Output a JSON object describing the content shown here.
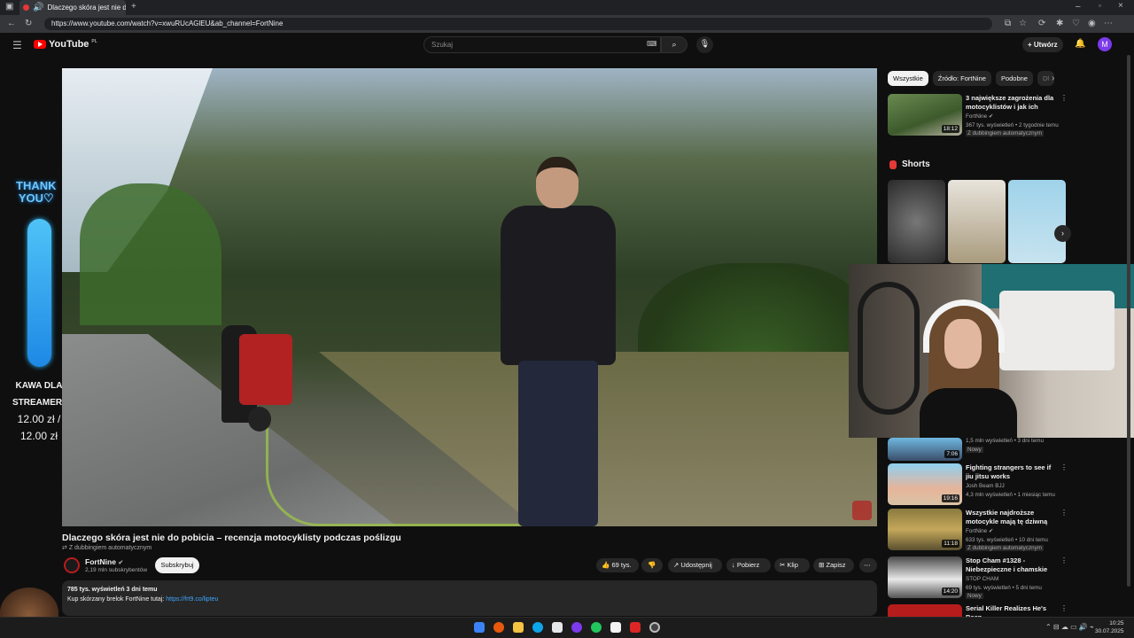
{
  "browser": {
    "tab_title": "Dlaczego skóra jest nie do p",
    "url": "https://www.youtube.com/watch?v=xwuRUcAGlEU&ab_channel=FortNine"
  },
  "youtube": {
    "logo_text": "YouTube",
    "logo_region": "PL",
    "search_placeholder": "Szukaj",
    "create_label": "Utwórz",
    "avatar_letter": "M"
  },
  "stream_overlay": {
    "thank_line1": "THANK",
    "thank_line2": "YOU",
    "kawa_line1": "KAWA DLA",
    "kawa_line2": "STREAMERKI",
    "amount1": "12.00 zł /",
    "amount2": "12.00 zł"
  },
  "video": {
    "title": "Dlaczego skóra jest nie do pobicia – recenzja motocyklisty podczas poślizgu",
    "dub_note": "Z dubbingiem automatycznym",
    "channel": "FortNine",
    "subscribers": "2,19 mln subskrybentów",
    "subscribe_label": "Subskrybuj",
    "likes": "69 tys.",
    "share_label": "Udostępnij",
    "download_label": "Pobierz",
    "clip_label": "Klip",
    "save_label": "Zapisz",
    "views_date": "785 tys. wyświetleń  3 dni temu",
    "desc_line": "Kup skórzany brelok FortNine tutaj:",
    "desc_link": "https://frt9.co/lipteu"
  },
  "sidebar": {
    "chips": [
      "Wszystkie",
      "Źródło: FortNine",
      "Podobne",
      "Dl"
    ],
    "shorts_title": "Shorts",
    "recs": [
      {
        "title": "3 największe zagrożenia dla motocyklistów i jak ich unikać",
        "channel": "FortNine",
        "meta": "367 tys. wyświetleń • 2 tygodnie temu",
        "extra": "Z dubbingiem automatycznym",
        "duration": "18:12"
      },
      {
        "title": "",
        "channel": "",
        "meta": "1,5 mln wyświetleń • 3 dni temu",
        "extra": "Nowy",
        "duration": "7:06"
      },
      {
        "title": "Fighting strangers to see if jiu jitsu works",
        "channel": "Josh Beam BJJ",
        "meta": "4,3 mln wyświetleń • 1 miesiąc temu",
        "extra": "",
        "duration": "19:16"
      },
      {
        "title": "Wszystkie najdroższe motocykle mają tę dziwną ...",
        "channel": "FortNine",
        "meta": "633 tys. wyświetleń • 10 dni temu",
        "extra": "Z dubbingiem automatycznym",
        "duration": "11:18"
      },
      {
        "title": "Stop Cham #1328 - Niebezpieczne i chamskie ...",
        "channel": "STOP CHAM",
        "meta": "69 tys. wyświetleń • 5 dni temu",
        "extra": "Nowy",
        "duration": "14:20"
      },
      {
        "title": "Serial Killer Realizes He's Been",
        "channel": "",
        "meta": "",
        "extra": "",
        "duration": ""
      }
    ]
  },
  "taskbar": {
    "time": "10:25",
    "date": "30.07.2025"
  }
}
